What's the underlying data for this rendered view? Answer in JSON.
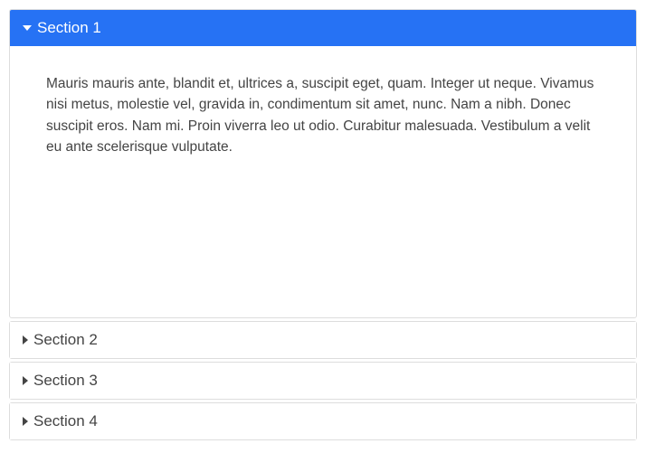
{
  "accordion": {
    "sections": [
      {
        "title": "Section 1",
        "expanded": true,
        "content": "Mauris mauris ante, blandit et, ultrices a, suscipit eget, quam. Integer ut neque. Vivamus nisi metus, molestie vel, gravida in, condimentum sit amet, nunc. Nam a nibh. Donec suscipit eros. Nam mi. Proin viverra leo ut odio. Curabitur malesuada. Vestibulum a velit eu ante scelerisque vulputate."
      },
      {
        "title": "Section 2",
        "expanded": false
      },
      {
        "title": "Section 3",
        "expanded": false
      },
      {
        "title": "Section 4",
        "expanded": false
      }
    ]
  },
  "colors": {
    "active_header_bg": "#2672f4",
    "active_header_text": "#ffffff",
    "inactive_header_text": "#444444",
    "border": "#dddddd"
  }
}
